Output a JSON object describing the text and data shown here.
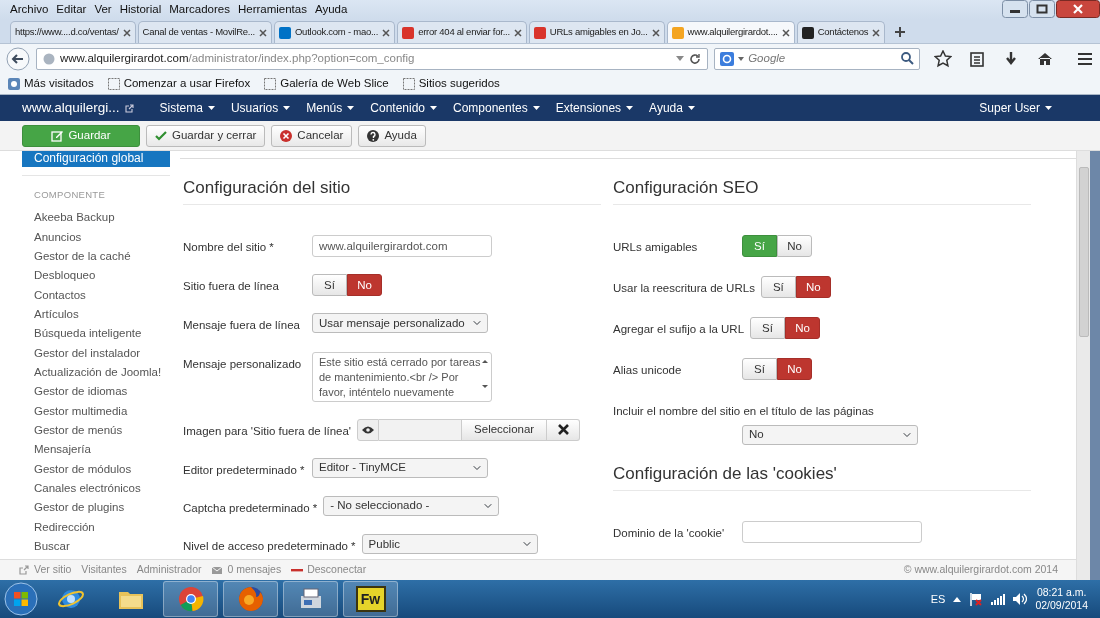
{
  "browser": {
    "menu": [
      "Archivo",
      "Editar",
      "Ver",
      "Historial",
      "Marcadores",
      "Herramientas",
      "Ayuda"
    ],
    "tabs": [
      {
        "label": "https://www....d.co/ventas/",
        "selected": false
      },
      {
        "label": "Canal de ventas - MovilRe...",
        "selected": false
      },
      {
        "label": "Outlook.com - mao...",
        "selected": false,
        "color": "#0072c6"
      },
      {
        "label": "error 404 al enviar for...",
        "selected": false,
        "color": "#d9342b"
      },
      {
        "label": "URLs amigables en Jo...",
        "selected": false,
        "color": "#d9342b"
      },
      {
        "label": "www.alquilergirardot....",
        "selected": true,
        "color": "#f4a522"
      },
      {
        "label": "Contáctenos",
        "selected": false,
        "color": "#222222"
      }
    ],
    "url": "**www.alquilergirardot.com**/administrator/index.php?option=com_config",
    "search": {
      "placeholder": "Google"
    },
    "bookmarks": [
      "Más visitados",
      "Comenzar a usar Firefox",
      "Galería de Web Slice",
      "Sitios sugeridos"
    ]
  },
  "admin": {
    "brand": "www.alquilergi...",
    "menus": [
      "Sistema",
      "Usuarios",
      "Menús",
      "Contenido",
      "Componentes",
      "Extensiones",
      "Ayuda"
    ],
    "user": "Super User"
  },
  "toolbar": [
    {
      "label": "Guardar",
      "kind": "save"
    },
    {
      "label": "Guardar y cerrar",
      "kind": "save-close"
    },
    {
      "label": "Cancelar",
      "kind": "cancel"
    },
    {
      "label": "Ayuda",
      "kind": "help"
    }
  ],
  "sidebar": {
    "current": {
      "label": "Configuración global",
      "selected": true
    },
    "heading": "COMPONENTE",
    "items": [
      {
        "label": "Akeeba Backup",
        "selected": false
      },
      {
        "label": "Anuncios",
        "selected": false
      },
      {
        "label": "Gestor de la caché",
        "selected": false
      },
      {
        "label": "Desbloqueo",
        "selected": false
      },
      {
        "label": "Contactos",
        "selected": false
      },
      {
        "label": "Artículos",
        "selected": false
      },
      {
        "label": "Búsqueda inteligente",
        "selected": false
      },
      {
        "label": "Gestor del instalador",
        "selected": false
      },
      {
        "label": "Actualización de Joomla!",
        "selected": false
      },
      {
        "label": "Gestor de idiomas",
        "selected": false
      },
      {
        "label": "Gestor multimedia",
        "selected": false
      },
      {
        "label": "Gestor de menús",
        "selected": false
      },
      {
        "label": "Mensajería",
        "selected": false
      },
      {
        "label": "Gestor de módulos",
        "selected": false
      },
      {
        "label": "Canales electrónicos",
        "selected": false
      },
      {
        "label": "Gestor de plugins",
        "selected": false
      },
      {
        "label": "Redirección",
        "selected": false
      },
      {
        "label": "Buscar",
        "selected": false
      }
    ]
  },
  "columns": [
    {
      "sections": [
        {
          "title": "Configuración del sitio",
          "fields": [
            {
              "kind": "text",
              "label": "Nombre del sitio *",
              "value": "www.alquilergirardot.com"
            },
            {
              "kind": "toggle",
              "label": "Sitio fuera de línea",
              "options": [
                {
                  "label": "Sí",
                  "selected": false
                },
                {
                  "label": "No",
                  "selected": true
                }
              ]
            },
            {
              "kind": "select",
              "label": "Mensaje fuera de línea",
              "value": "Usar mensaje personalizado"
            },
            {
              "kind": "textarea",
              "label": "Mensaje personalizado",
              "value": "Este sitio está cerrado por tareas de mantenimiento.<br /> Por favor, inténtelo nuevamente"
            },
            {
              "kind": "media",
              "label": "Imagen para 'Sitio fuera de línea'",
              "button": "Seleccionar"
            },
            {
              "kind": "select",
              "label": "Editor predeterminado *",
              "value": "Editor - TinyMCE"
            },
            {
              "kind": "select",
              "label": "Captcha predeterminado *",
              "value": "- No seleccionado -"
            },
            {
              "kind": "select",
              "label": "Nivel de acceso predeterminado *",
              "value": "Public"
            }
          ]
        }
      ]
    },
    {
      "sections": [
        {
          "title": "Configuración SEO",
          "fields": [
            {
              "kind": "toggle",
              "label": "URLs amigables",
              "options": [
                {
                  "label": "Sí",
                  "selected": true
                },
                {
                  "label": "No",
                  "selected": false
                }
              ]
            },
            {
              "kind": "toggle",
              "label": "Usar la reescritura de URLs",
              "options": [
                {
                  "label": "Sí",
                  "selected": false
                },
                {
                  "label": "No",
                  "selected": true
                }
              ]
            },
            {
              "kind": "toggle",
              "label": "Agregar el sufijo a la URL",
              "options": [
                {
                  "label": "Sí",
                  "selected": false
                },
                {
                  "label": "No",
                  "selected": true
                }
              ]
            },
            {
              "kind": "toggle",
              "label": "Alias unicode",
              "options": [
                {
                  "label": "Sí",
                  "selected": false
                },
                {
                  "label": "No",
                  "selected": true
                }
              ]
            },
            {
              "kind": "select",
              "label": "Incluir el nombre del sitio en el título de las páginas",
              "value": "No",
              "stacked": true
            }
          ]
        },
        {
          "title": "Configuración de las 'cookies'",
          "fields": [
            {
              "kind": "text",
              "label": "Dominio de la 'cookie'"
            }
          ]
        }
      ]
    }
  ],
  "status_bar": {
    "links": [
      {
        "label": "Ver sitio",
        "kind": "external"
      },
      {
        "label": "Visitantes",
        "kind": "plain"
      },
      {
        "label": "Administrador",
        "kind": "plain"
      },
      {
        "label": "0 mensajes",
        "kind": "mail"
      },
      {
        "label": "Desconectar",
        "kind": "logout"
      }
    ],
    "copyright": "© www.alquilergirardot.com 2014"
  },
  "taskbar": {
    "apps": [
      {
        "kind": "ie",
        "running": false
      },
      {
        "kind": "folder",
        "running": false
      },
      {
        "kind": "chrome",
        "running": true
      },
      {
        "kind": "firefox",
        "running": true
      },
      {
        "kind": "fax",
        "running": true
      },
      {
        "kind": "fireworks",
        "running": true,
        "label": "Fw"
      }
    ],
    "language": "ES",
    "time": "08:21 a.m.",
    "date": "02/09/2014"
  }
}
